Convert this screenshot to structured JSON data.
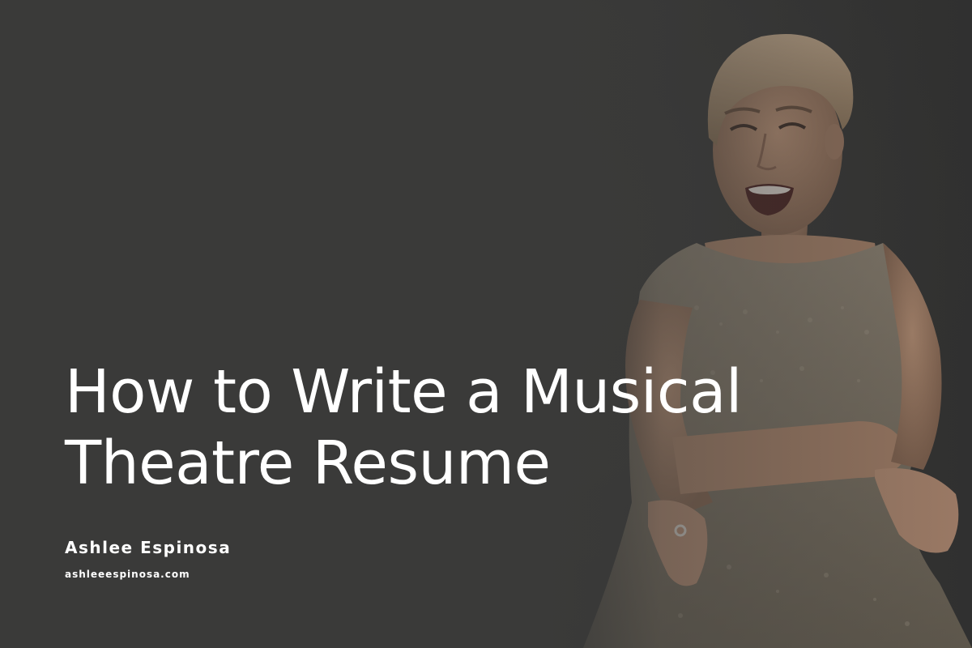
{
  "hero": {
    "title_line1": "How to Write a Musical",
    "title_line2": "Theatre Resume",
    "author": "Ashlee Espinosa",
    "website": "ashleeespinosa.com"
  },
  "photo": {
    "subject": "portrait-photo-woman-laughing",
    "colors": {
      "background": "#3a3a39",
      "skin": "#b98f72",
      "hair": "#c4a584",
      "dress": "#8c8170"
    }
  }
}
